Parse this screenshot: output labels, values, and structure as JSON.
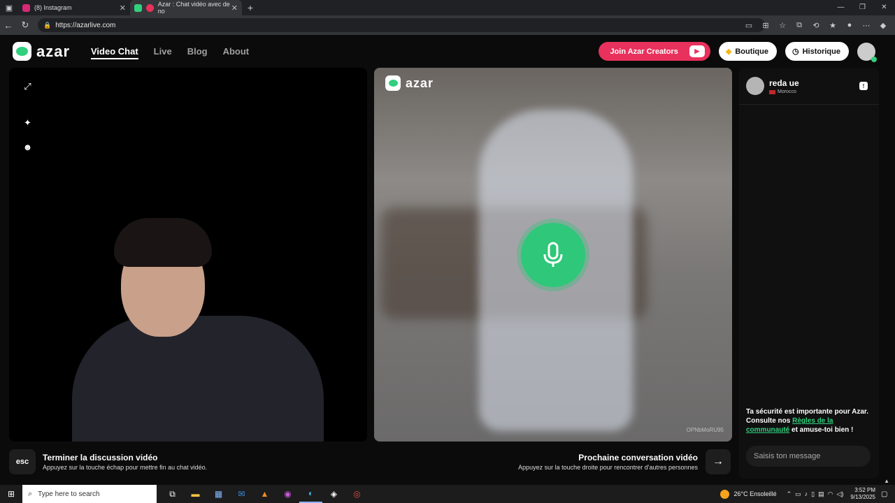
{
  "browser": {
    "tabs": [
      {
        "title": "(8) Instagram",
        "color": "#d62976"
      },
      {
        "title": "Azar : Chat vidéo avec de no",
        "color": "#31d07e"
      }
    ],
    "url": "https://azarlive.com"
  },
  "header": {
    "logo": "azar",
    "nav": [
      "Video Chat",
      "Live",
      "Blog",
      "About"
    ],
    "creators_label": "Join Azar Creators",
    "boutique_label": "Boutique",
    "historique_label": "Historique"
  },
  "video": {
    "remote_logo": "azar",
    "watermark": "OPNbMoRU95"
  },
  "controls": {
    "esc_key": "esc",
    "end_title": "Terminer la discussion vidéo",
    "end_sub": "Appuyez sur la touche échap pour mettre fin au chat vidéo.",
    "next_title": "Prochaine conversation vidéo",
    "next_sub": "Appuyez sur la touche droite pour rencontrer d'autres personnes"
  },
  "chat": {
    "partner_name": "reda ue",
    "partner_country": "Morocco",
    "safety_pre": "Ta sécurité est importante pour Azar. Consulte nos ",
    "safety_link": "Règles de la communauté",
    "safety_post": " et amuse-toi bien !",
    "input_placeholder": "Saisis ton message"
  },
  "taskbar": {
    "search_placeholder": "Type here to search",
    "weather": "26°C  Ensoleillé",
    "time": "3:52 PM",
    "date": "9/13/2025"
  },
  "colors": {
    "accent_green": "#31d07e",
    "creators_red": "#e8315c"
  }
}
